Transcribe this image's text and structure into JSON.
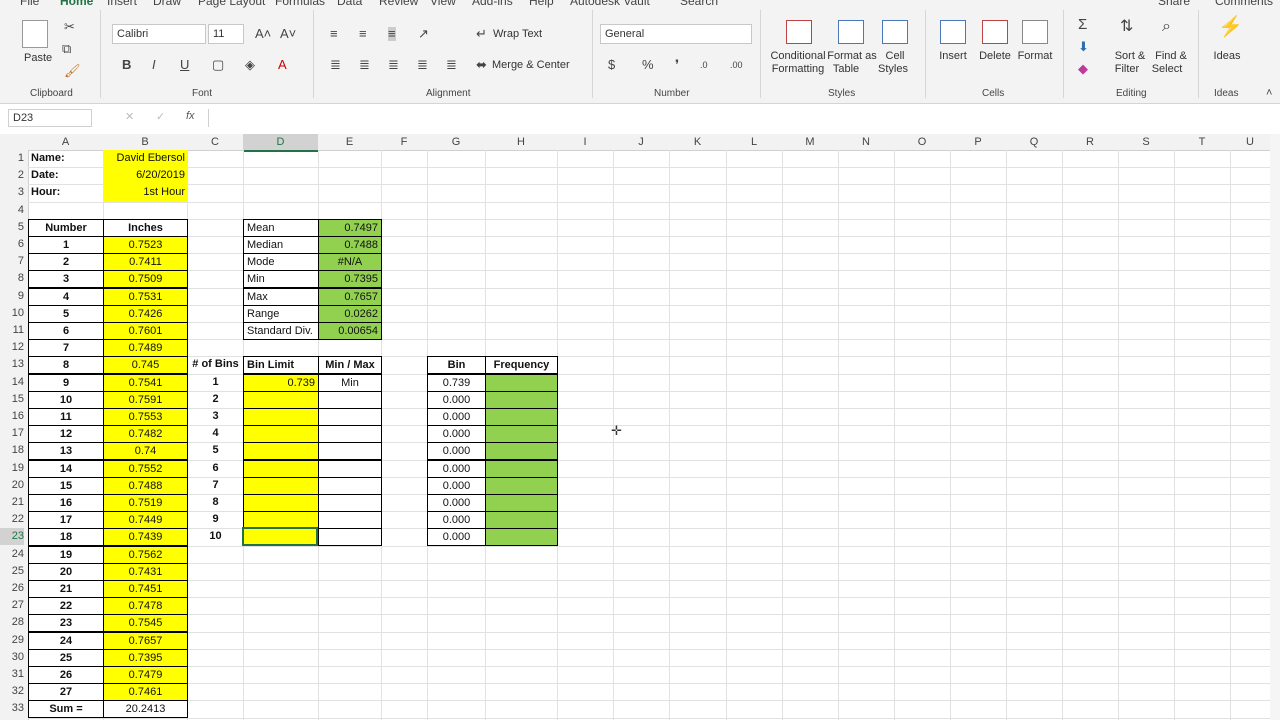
{
  "tabs": [
    "File",
    "Home",
    "Insert",
    "Draw",
    "Page Layout",
    "Formulas",
    "Data",
    "Review",
    "View",
    "Add-ins",
    "Help",
    "Autodesk Vault",
    "Search"
  ],
  "share": "Share",
  "comments": "Comments",
  "ribbon": {
    "clipboard": {
      "label": "Clipboard",
      "paste": "Paste"
    },
    "font": {
      "label": "Font",
      "family": "Calibri",
      "size": "11"
    },
    "alignment": {
      "label": "Alignment",
      "wrap": "Wrap Text",
      "merge": "Merge & Center"
    },
    "number": {
      "label": "Number",
      "format": "General"
    },
    "styles": {
      "label": "Styles",
      "cond1": "Conditional",
      "cond2": "Formatting",
      "fmt1": "Format as",
      "fmt2": "Table",
      "cell1": "Cell",
      "cell2": "Styles"
    },
    "cells": {
      "label": "Cells",
      "insert": "Insert",
      "delete": "Delete",
      "format": "Format"
    },
    "editing": {
      "label": "Editing",
      "sort1": "Sort &",
      "sort2": "Filter",
      "find1": "Find &",
      "find2": "Select"
    },
    "ideas": {
      "label": "Ideas",
      "btn": "Ideas"
    }
  },
  "formula_bar": {
    "namebox": "D23",
    "fx": "fx"
  },
  "columns": [
    "A",
    "B",
    "C",
    "D",
    "E",
    "F",
    "G",
    "H",
    "I",
    "J",
    "K",
    "L",
    "M",
    "N",
    "O",
    "P",
    "Q",
    "R",
    "S",
    "T",
    "U"
  ],
  "header": {
    "name_label": "Name:",
    "name_value": "David Ebersol",
    "date_label": "Date:",
    "date_value": "6/20/2019",
    "hour_label": "Hour:",
    "hour_value": "1st Hour"
  },
  "measure_table": {
    "col_number": "Number",
    "col_inches": "Inches",
    "rows": [
      [
        "1",
        "0.7523"
      ],
      [
        "2",
        "0.7411"
      ],
      [
        "3",
        "0.7509"
      ],
      [
        "4",
        "0.7531"
      ],
      [
        "5",
        "0.7426"
      ],
      [
        "6",
        "0.7601"
      ],
      [
        "7",
        "0.7489"
      ],
      [
        "8",
        "0.745"
      ],
      [
        "9",
        "0.7541"
      ],
      [
        "10",
        "0.7591"
      ],
      [
        "11",
        "0.7553"
      ],
      [
        "12",
        "0.7482"
      ],
      [
        "13",
        "0.74"
      ],
      [
        "14",
        "0.7552"
      ],
      [
        "15",
        "0.7488"
      ],
      [
        "16",
        "0.7519"
      ],
      [
        "17",
        "0.7449"
      ],
      [
        "18",
        "0.7439"
      ],
      [
        "19",
        "0.7562"
      ],
      [
        "20",
        "0.7431"
      ],
      [
        "21",
        "0.7451"
      ],
      [
        "22",
        "0.7478"
      ],
      [
        "23",
        "0.7545"
      ],
      [
        "24",
        "0.7657"
      ],
      [
        "25",
        "0.7395"
      ],
      [
        "26",
        "0.7479"
      ],
      [
        "27",
        "0.7461"
      ]
    ],
    "sum_label": "Sum =",
    "sum_value": "20.2413"
  },
  "stats": [
    [
      "Mean",
      "0.7497"
    ],
    [
      "Median",
      "0.7488"
    ],
    [
      "Mode",
      "#N/A"
    ],
    [
      "Min",
      "0.7395"
    ],
    [
      "Max",
      "0.7657"
    ],
    [
      "Range",
      "0.0262"
    ],
    [
      "Standard Div.",
      "0.00654"
    ]
  ],
  "bins_table": {
    "col_bins": "# of Bins",
    "col_limit": "Bin Limit",
    "col_minmax": "Min / Max",
    "rows": [
      [
        "1",
        "0.739",
        "Min"
      ],
      [
        "2",
        "",
        ""
      ],
      [
        "3",
        "",
        ""
      ],
      [
        "4",
        "",
        ""
      ],
      [
        "5",
        "",
        ""
      ],
      [
        "6",
        "",
        ""
      ],
      [
        "7",
        "",
        ""
      ],
      [
        "8",
        "",
        ""
      ],
      [
        "9",
        "",
        ""
      ],
      [
        "10",
        "",
        ""
      ]
    ]
  },
  "freq_table": {
    "col_bin": "Bin",
    "col_freq": "Frequency",
    "bins": [
      "0.739",
      "0.000",
      "0.000",
      "0.000",
      "0.000",
      "0.000",
      "0.000",
      "0.000",
      "0.000",
      "0.000"
    ]
  }
}
